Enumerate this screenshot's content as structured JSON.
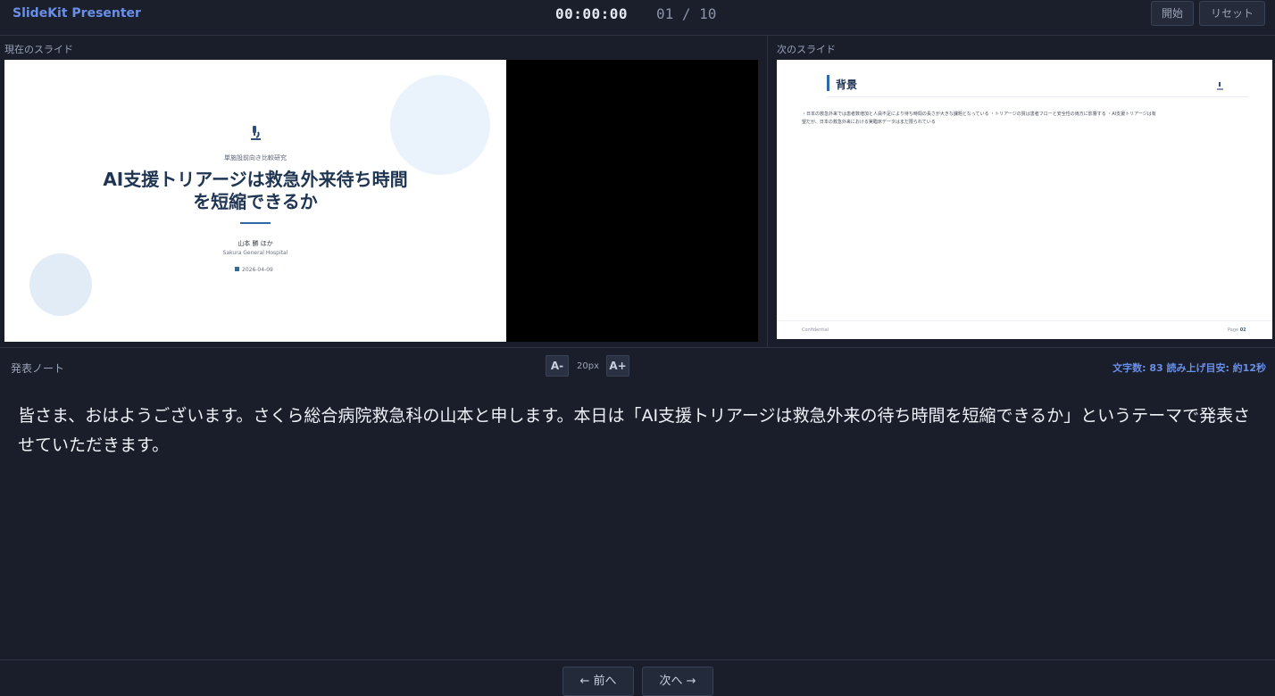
{
  "header": {
    "app_title": "SlideKit Presenter",
    "timer": "00:00:00",
    "counter": "01 / 10",
    "start_label": "開始",
    "reset_label": "リセット"
  },
  "current": {
    "label": "現在のスライド",
    "subtitle": "単施設前向き比較研究",
    "title": "AI支援トリアージは救急外来待ち時間を短縮できるか",
    "author": "山本 勝 ほか",
    "org": "Sakura General Hospital",
    "date": "2026-04-09"
  },
  "next": {
    "label": "次のスライド",
    "title": "背景",
    "body": "・日本の救急外来では患者数増加と人員不足により待ち時間の長さが大きな課題となっている ・トリアージの質は患者フローと安全性の両方に影響する ・AI支援トリアージは有望だが、日本の救急外来における実臨床データはまだ限られている",
    "footer_left": "Confidential",
    "page_prefix": "Page",
    "page_num": "02"
  },
  "notes": {
    "label": "発表ノート",
    "font_minus": "A-",
    "font_plus": "A+",
    "font_size": "20px",
    "stats": "文字数: 83  読み上げ目安: 約12秒",
    "text": "皆さま、おはようございます。さくら総合病院救急科の山本と申します。本日は「AI支援トリアージは救急外来の待ち時間を短縮できるか」というテーマで発表させていただきます。"
  },
  "nav": {
    "prev_label": "← 前へ",
    "next_label": "次へ →"
  },
  "colors": {
    "accent": "#6a8fe8",
    "slide_navy": "#1f3552",
    "slide_blue": "#2f6aa8"
  }
}
